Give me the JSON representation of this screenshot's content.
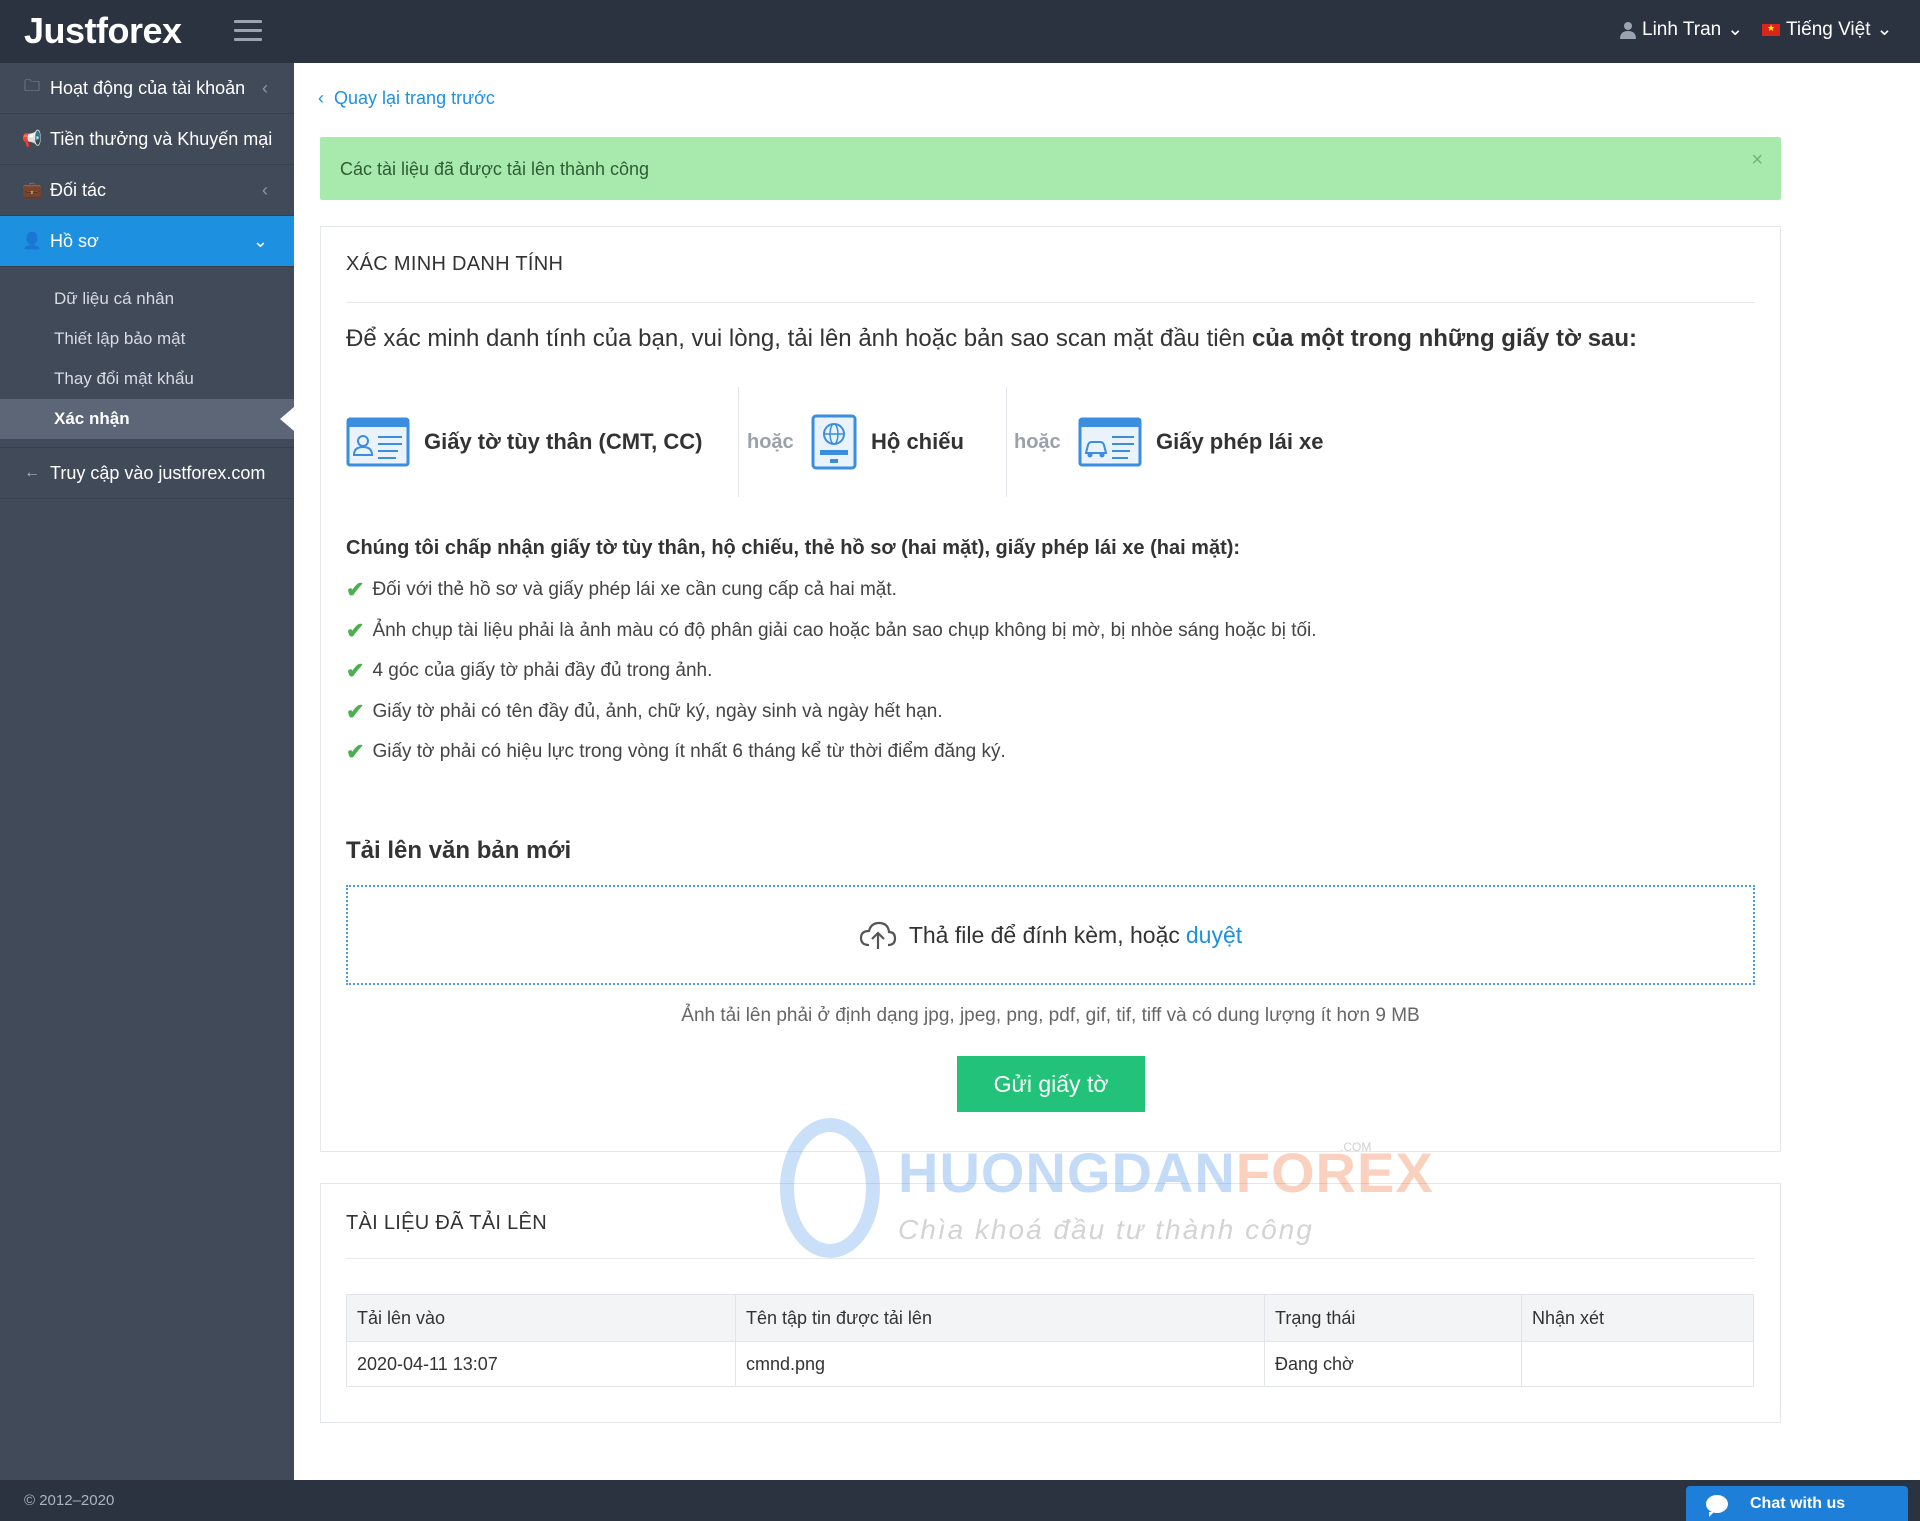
{
  "header": {
    "logo": "Justforex",
    "user_name": "Linh Tran",
    "language": "Tiếng Việt"
  },
  "sidebar": {
    "items": [
      {
        "label": "Hoạt động của tài khoản"
      },
      {
        "label": "Tiền thưởng và Khuyến mại"
      },
      {
        "label": "Đối tác"
      },
      {
        "label": "Hồ sơ"
      },
      {
        "label": "Truy cập vào justforex.com"
      }
    ],
    "profile_sub": [
      {
        "label": "Dữ liệu cá nhân"
      },
      {
        "label": "Thiết lập bảo mật"
      },
      {
        "label": "Thay đổi mật khẩu"
      },
      {
        "label": "Xác nhận"
      }
    ]
  },
  "main": {
    "back_link": "Quay lại trang trước",
    "alert": "Các tài liệu đã được tải lên thành công",
    "verify": {
      "title": "XÁC MINH DANH TÍNH",
      "intro_plain": "Để xác minh danh tính của bạn, vui lòng, tải lên ảnh hoặc bản sao scan mặt đầu tiên ",
      "intro_bold": "của một trong những giấy tờ sau:",
      "doc_types": [
        {
          "label": "Giấy tờ tùy thân (CMT, CC)",
          "icon": "id-card-icon"
        },
        {
          "label": "Hộ chiếu",
          "icon": "passport-icon"
        },
        {
          "label": "Giấy phép lái xe",
          "icon": "driver-license-icon"
        }
      ],
      "or_word": "hoặc",
      "accept_title": "Chúng tôi chấp nhận giấy tờ tùy thân, hộ chiếu, thẻ hồ sơ (hai mặt), giấy phép lái xe (hai mặt):",
      "rules": [
        "Đối với thẻ hồ sơ và giấy phép lái xe cần cung cấp cả hai mặt.",
        "Ảnh chụp tài liệu phải là ảnh màu có độ phân giải cao hoặc bản sao chụp không bị mờ, bị nhòe sáng hoặc bị tối.",
        "4 góc của giấy tờ phải đầy đủ trong ảnh.",
        "Giấy tờ phải có tên đầy đủ, ảnh, chữ ký, ngày sinh và ngày hết hạn.",
        "Giấy tờ phải có hiệu lực trong vòng ít nhất 6 tháng kể từ thời điểm đăng ký."
      ],
      "upload_title": "Tải lên văn bản mới",
      "dropzone_text": "Thả file để đính kèm, hoặc",
      "dropzone_browse": "duyệt",
      "hint": "Ảnh tải lên phải ở định dạng jpg, jpeg, png, pdf, gif, tif, tiff và có dung lượng ít hơn 9 MB",
      "submit": "Gửi giấy tờ"
    },
    "uploaded": {
      "title": "TÀI LIỆU ĐÃ TẢI LÊN",
      "columns": [
        "Tải lên vào",
        "Tên tập tin được tải lên",
        "Trạng thái",
        "Nhận xét"
      ],
      "rows": [
        [
          "2020-04-11 13:07",
          "cmnd.png",
          "Đang chờ",
          ""
        ]
      ]
    }
  },
  "watermark": {
    "brand_blue": "HUONGDAN",
    "brand_orange": "FOREX",
    "com": ".COM",
    "tagline": "Chìa khoá đầu tư thành công"
  },
  "footer": {
    "copyright": "© 2012–2020",
    "chat": "Chat with us"
  },
  "colors": {
    "topbar": "#2b3240",
    "sidebar": "#414a59",
    "accent": "#1e90e0",
    "success_alert": "#a8eaad",
    "submit": "#22c27a"
  }
}
